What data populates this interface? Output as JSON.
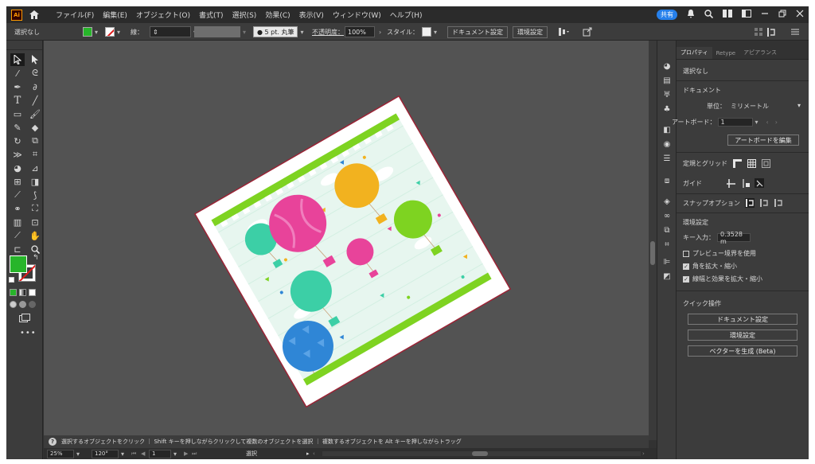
{
  "app": {
    "logo": "Ai"
  },
  "menu": [
    "ファイル(F)",
    "編集(E)",
    "オブジェクト(O)",
    "書式(T)",
    "選択(S)",
    "効果(C)",
    "表示(V)",
    "ウィンドウ(W)",
    "ヘルプ(H)"
  ],
  "menubar_right": {
    "share": "共有"
  },
  "control": {
    "selection": "選択なし",
    "stroke_label": "線：",
    "brush": "● 5 pt. 丸筆",
    "opacity_label": "不透明度：",
    "opacity_value": "100%",
    "style_label": "スタイル：",
    "doc_setup": "ドキュメント設定",
    "prefs": "環境設定"
  },
  "hint": "選択するオブジェクトをクリック ｜ Shift キーを押しながらクリックして複数のオブジェクトを選択 ｜ 複数するオブジェクトを Alt キーを押しながらトラッグ",
  "status": {
    "zoom": "25%",
    "angle": "120°",
    "artboard": "1",
    "mode": "選択"
  },
  "properties": {
    "tabs": [
      "プロパティ",
      "Retype",
      "アピアランス"
    ],
    "no_selection": "選択なし",
    "document_heading": "ドキュメント",
    "units_label": "単位：",
    "units_value": "ミリメートル",
    "artboard_label": "アートボード：",
    "artboard_value": "1",
    "edit_artboard": "アートボードを編集",
    "rulers_grids": "定規とグリッド",
    "guides": "ガイド",
    "snap_options": "スナップオプション",
    "prefs_heading": "環境設定",
    "key_increment_label": "キー入力：",
    "key_increment_value": "0.3528 m",
    "use_preview_bounds": "プレビュー境界を使用",
    "scale_corners": "角を拡大・縮小",
    "scale_strokes": "線幅と効果を拡大・縮小",
    "quick_actions": "クイック操作",
    "qa_doc_setup": "ドキュメント設定",
    "qa_prefs": "環境設定",
    "qa_vectorize": "ベクターを生成 (Beta)"
  },
  "colors": {
    "fill": "#27b52a",
    "stroke_none": "#e01b1b",
    "pink": "#e8439a",
    "yellow": "#f2b21f",
    "teal": "#3ccfa6",
    "blue": "#2f86d6",
    "lime": "#7ed321",
    "accent": "#2680eb"
  }
}
